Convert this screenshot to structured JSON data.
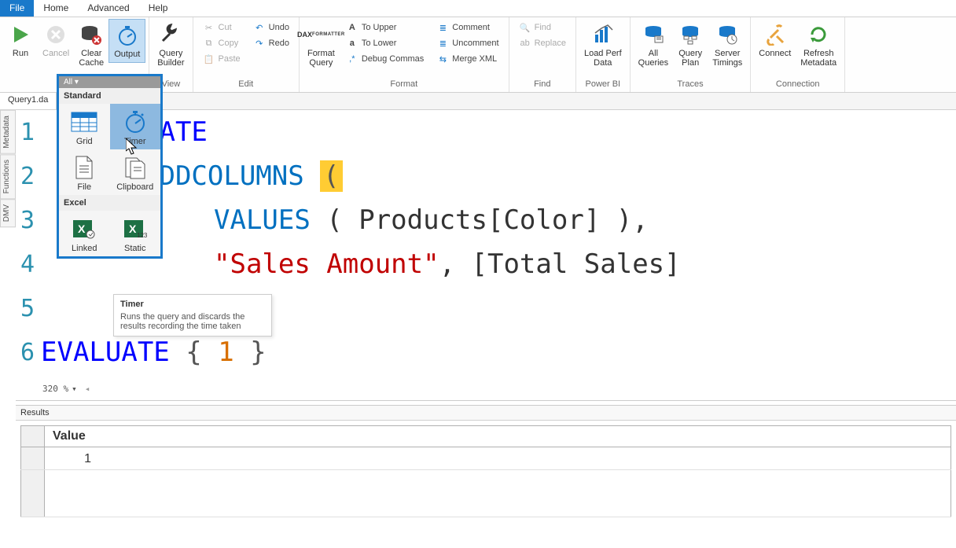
{
  "menu": {
    "file": "File",
    "home": "Home",
    "advanced": "Advanced",
    "help": "Help"
  },
  "ribbon": {
    "run": "Run",
    "cancel": "Cancel",
    "clear": "Clear\nCache",
    "output": "Output",
    "queryBuilder": "Query\nBuilder",
    "view": "View",
    "cut": "Cut",
    "copy": "Copy",
    "paste": "Paste",
    "undo": "Undo",
    "redo": "Redo",
    "edit": "Edit",
    "formatQuery": "Format\nQuery",
    "toUpper": "To Upper",
    "toLower": "To Lower",
    "debugCommas": "Debug Commas",
    "comment": "Comment",
    "uncomment": "Uncomment",
    "mergeXml": "Merge XML",
    "format": "Format",
    "find": "Find",
    "replace": "Replace",
    "findGroup": "Find",
    "loadPerf": "Load Perf\nData",
    "powerbi": "Power BI",
    "allQueries": "All\nQueries",
    "queryPlan": "Query\nPlan",
    "serverTimings": "Server\nTimings",
    "traces": "Traces",
    "connect": "Connect",
    "refreshMeta": "Refresh\nMetadata",
    "connection": "Connection"
  },
  "docTab": "Query1.da",
  "sideTabs": {
    "metadata": "Metadata",
    "functions": "Functions",
    "dmv": "DMV"
  },
  "dropdown": {
    "all": "All ▾",
    "standard": "Standard",
    "grid": "Grid",
    "timer": "Timer",
    "file": "File",
    "clipboard": "Clipboard",
    "excel": "Excel",
    "linked": "Linked",
    "static": "Static"
  },
  "tooltip": {
    "title": "Timer",
    "body": "Runs the query and discards the results recording the time taken"
  },
  "code": {
    "l1_evaluate": "UATE",
    "l2_fn": "ADDCOLUMNS ",
    "l2_paren": "(",
    "l3_fn": "VALUES",
    "l3_rest": " ( Products[Color] ),",
    "l4_str": "\"Sales Amount\"",
    "l4_rest": ", [Total Sales]",
    "l6_kw": "EVALUATE",
    "l6_brace1": " { ",
    "l6_num": "1",
    "l6_brace2": " }"
  },
  "zoom": "320 %",
  "results": {
    "header": "Results",
    "col": "Value",
    "val": "1"
  }
}
